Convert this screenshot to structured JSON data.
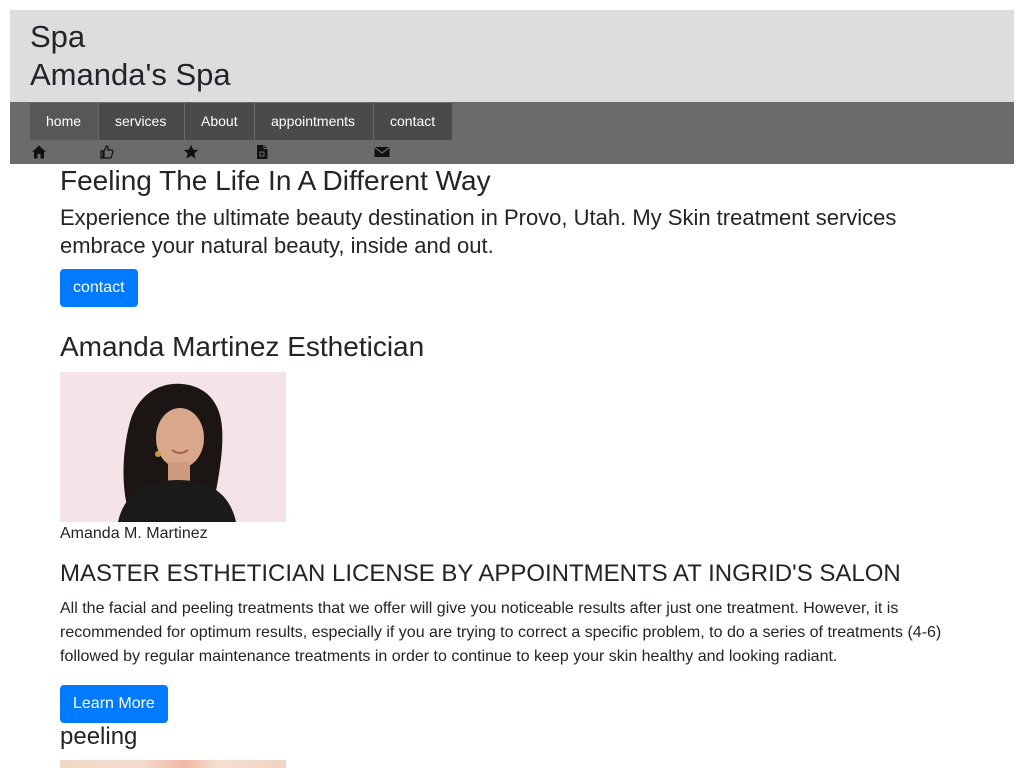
{
  "header": {
    "kicker": "Spa",
    "title": "Amanda's Spa"
  },
  "nav": {
    "items": [
      {
        "label": "home",
        "active": true
      },
      {
        "label": "services",
        "active": false
      },
      {
        "label": "About",
        "active": false
      },
      {
        "label": "appointments",
        "active": false
      },
      {
        "label": "contact",
        "active": false
      }
    ],
    "icons": [
      "home-icon",
      "thumbs-up-icon",
      "star-icon",
      "document-icon",
      "envelope-icon"
    ]
  },
  "hero": {
    "heading": "Feeling The Life In A Different Way",
    "lead": "Experience the ultimate beauty destination in Provo, Utah. My Skin treatment services embrace your natural beauty, inside and out.",
    "button_label": "contact"
  },
  "profile": {
    "heading": "Amanda Martinez Esthetician",
    "caption": "Amanda M. Martinez"
  },
  "license": {
    "heading": "MASTER ESTHETICIAN LICENSE BY APPOINTMENTS AT INGRID'S SALON",
    "body": "All the facial and peeling treatments that we offer will give you noticeable results after just one treatment. However, it is recommended for optimum results, especially if you are trying to correct a specific problem, to do a series of treatments (4-6) followed by regular maintenance treatments in order to continue to keep your skin healthy and looking radiant.",
    "button_label": "Learn More"
  },
  "peeling": {
    "heading": "peeling"
  },
  "colors": {
    "header_bg": "#dddddd",
    "nav_bg": "#6b6b6b",
    "nav_bar": "#4a4a4a",
    "primary": "#007bff"
  }
}
